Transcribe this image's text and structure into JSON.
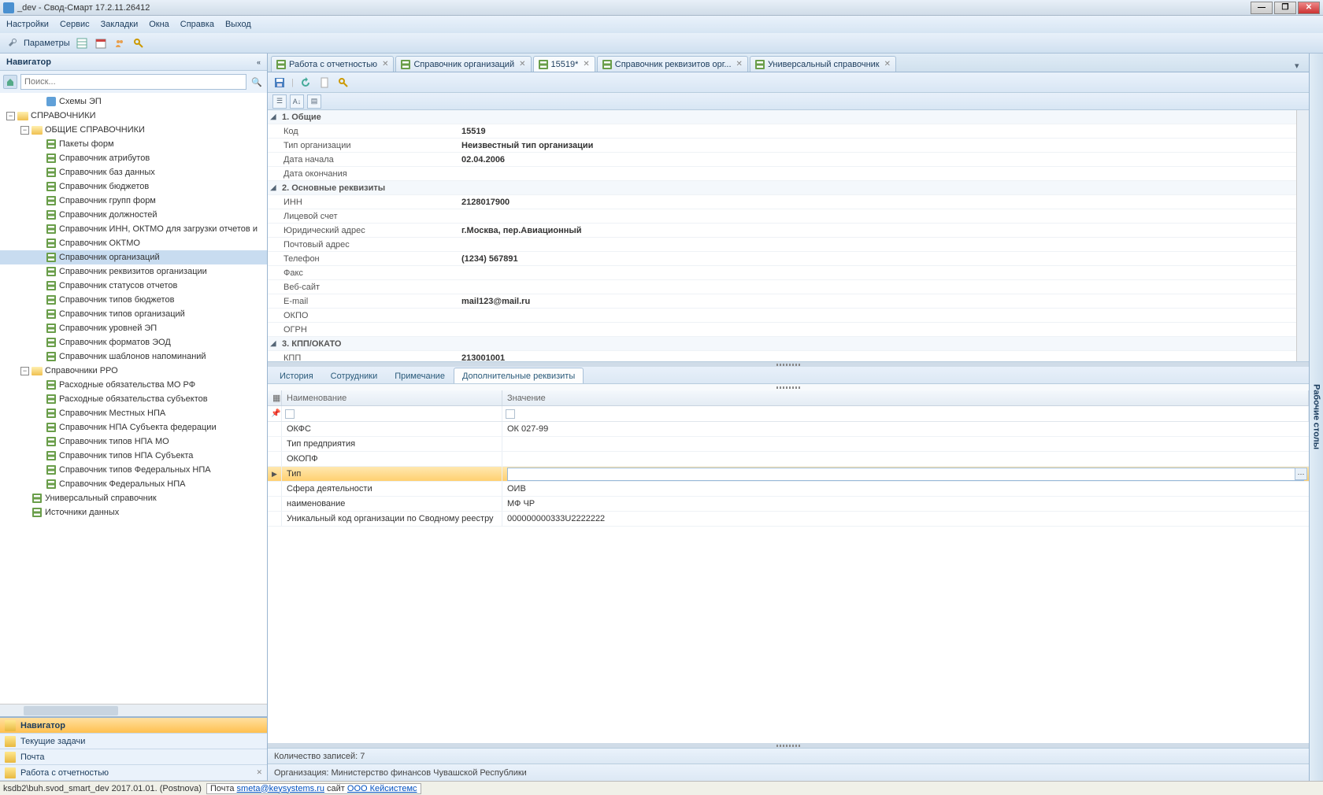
{
  "window": {
    "title": "_dev - Свод-Смарт 17.2.11.26412"
  },
  "menubar": [
    "Настройки",
    "Сервис",
    "Закладки",
    "Окна",
    "Справка",
    "Выход"
  ],
  "toolbar1": {
    "params": "Параметры"
  },
  "navigator": {
    "title": "Навигатор",
    "search_placeholder": "Поиск...",
    "tree": [
      {
        "lvl": 2,
        "icon": "blue",
        "label": "Схемы ЭП"
      },
      {
        "lvl": 0,
        "icon": "folder-open",
        "label": "СПРАВОЧНИКИ",
        "exp": "-"
      },
      {
        "lvl": 1,
        "icon": "folder-open",
        "label": "ОБЩИЕ СПРАВОЧНИКИ",
        "exp": "-"
      },
      {
        "lvl": 2,
        "icon": "grid",
        "label": "Пакеты форм"
      },
      {
        "lvl": 2,
        "icon": "grid",
        "label": "Справочник атрибутов"
      },
      {
        "lvl": 2,
        "icon": "grid",
        "label": "Справочник баз данных"
      },
      {
        "lvl": 2,
        "icon": "grid",
        "label": "Справочник бюджетов"
      },
      {
        "lvl": 2,
        "icon": "grid",
        "label": "Справочник групп форм"
      },
      {
        "lvl": 2,
        "icon": "grid",
        "label": "Справочник должностей"
      },
      {
        "lvl": 2,
        "icon": "grid",
        "label": "Справочник ИНН, ОКТМО для загрузки отчетов и"
      },
      {
        "lvl": 2,
        "icon": "grid",
        "label": "Справочник ОКТМО"
      },
      {
        "lvl": 2,
        "icon": "grid",
        "label": "Справочник организаций",
        "selected": true
      },
      {
        "lvl": 2,
        "icon": "grid",
        "label": "Справочник реквизитов организации"
      },
      {
        "lvl": 2,
        "icon": "grid",
        "label": "Справочник статусов отчетов"
      },
      {
        "lvl": 2,
        "icon": "grid",
        "label": "Справочник типов бюджетов"
      },
      {
        "lvl": 2,
        "icon": "grid",
        "label": "Справочник типов организаций"
      },
      {
        "lvl": 2,
        "icon": "grid",
        "label": "Справочник уровней ЭП"
      },
      {
        "lvl": 2,
        "icon": "grid",
        "label": "Справочник форматов ЭОД"
      },
      {
        "lvl": 2,
        "icon": "grid",
        "label": "Справочник шаблонов напоминаний"
      },
      {
        "lvl": 1,
        "icon": "folder-open",
        "label": "Справочники РРО",
        "exp": "-"
      },
      {
        "lvl": 2,
        "icon": "grid",
        "label": "Расходные обязательства МО РФ"
      },
      {
        "lvl": 2,
        "icon": "grid",
        "label": "Расходные обязательства субъектов"
      },
      {
        "lvl": 2,
        "icon": "grid",
        "label": "Справочник Местных НПА"
      },
      {
        "lvl": 2,
        "icon": "grid",
        "label": "Справочник НПА Субъекта федерации"
      },
      {
        "lvl": 2,
        "icon": "grid",
        "label": "Справочник типов НПА МО"
      },
      {
        "lvl": 2,
        "icon": "grid",
        "label": "Справочник типов НПА Субъекта"
      },
      {
        "lvl": 2,
        "icon": "grid",
        "label": "Справочник типов Федеральных НПА"
      },
      {
        "lvl": 2,
        "icon": "grid",
        "label": "Справочник Федеральных НПА"
      },
      {
        "lvl": 1,
        "icon": "grid",
        "label": "Универсальный справочник"
      },
      {
        "lvl": 1,
        "icon": "grid",
        "label": "Источники данных"
      }
    ],
    "bottom": [
      {
        "label": "Навигатор",
        "active": true,
        "x": false
      },
      {
        "label": "Текущие задачи",
        "active": false,
        "x": false
      },
      {
        "label": "Почта",
        "active": false,
        "x": false
      },
      {
        "label": "Работа с отчетностью",
        "active": false,
        "x": true
      }
    ]
  },
  "tabs": [
    {
      "label": "Работа с отчетностью",
      "active": false
    },
    {
      "label": "Справочник организаций",
      "active": false
    },
    {
      "label": "15519*",
      "active": true
    },
    {
      "label": "Справочник реквизитов орг...",
      "active": false
    },
    {
      "label": "Универсальный справочник",
      "active": false
    }
  ],
  "propgrid": {
    "groups": [
      {
        "title": "1. Общие",
        "rows": [
          {
            "label": "Код",
            "value": "15519"
          },
          {
            "label": "Тип организации",
            "value": "Неизвестный тип организации"
          },
          {
            "label": "Дата начала",
            "value": "02.04.2006"
          },
          {
            "label": "Дата окончания",
            "value": ""
          }
        ]
      },
      {
        "title": "2. Основные реквизиты",
        "rows": [
          {
            "label": "ИНН",
            "value": "2128017900"
          },
          {
            "label": "Лицевой счет",
            "value": ""
          },
          {
            "label": "Юридический адрес",
            "value": "г.Москва, пер.Авиационный"
          },
          {
            "label": "Почтовый адрес",
            "value": ""
          },
          {
            "label": "Телефон",
            "value": "(1234) 567891"
          },
          {
            "label": "Факс",
            "value": ""
          },
          {
            "label": "Веб-сайт",
            "value": ""
          },
          {
            "label": "E-mail",
            "value": "mail123@mail.ru"
          },
          {
            "label": "ОКПО",
            "value": ""
          },
          {
            "label": "ОГРН",
            "value": ""
          }
        ]
      },
      {
        "title": "3. КПП/ОКАТО",
        "rows": [
          {
            "label": "КПП",
            "value": "213001001"
          }
        ]
      }
    ]
  },
  "subtabs": [
    "История",
    "Сотрудники",
    "Примечание",
    "Дополнительные реквизиты"
  ],
  "subtab_active": 3,
  "grid": {
    "col_name": "Наименование",
    "col_value": "Значение",
    "rows": [
      {
        "name": "ОКФС",
        "value": "ОК 027-99"
      },
      {
        "name": "Тип предприятия",
        "value": ""
      },
      {
        "name": "ОКОПФ",
        "value": ""
      },
      {
        "name": "Тип",
        "value": "",
        "editing": true
      },
      {
        "name": "Сфера деятельности",
        "value": "ОИВ"
      },
      {
        "name": "наименование",
        "value": "МФ ЧР"
      },
      {
        "name": "Уникальный код организации по Сводному реестру",
        "value": "000000000333U2222222"
      }
    ]
  },
  "footer": {
    "count": "Количество записей: 7",
    "org": "Организация: Министерство финансов Чувашской Республики"
  },
  "vside": "Рабочие столы",
  "status": {
    "db": "ksdb2\\buh.svod_smart_dev 2017.01.01. (Postnova)",
    "mail_prefix": "Почта ",
    "mail": "smeta@keysystems.ru",
    "site_prefix": " сайт ",
    "site": "ООО Кейсистемс"
  }
}
